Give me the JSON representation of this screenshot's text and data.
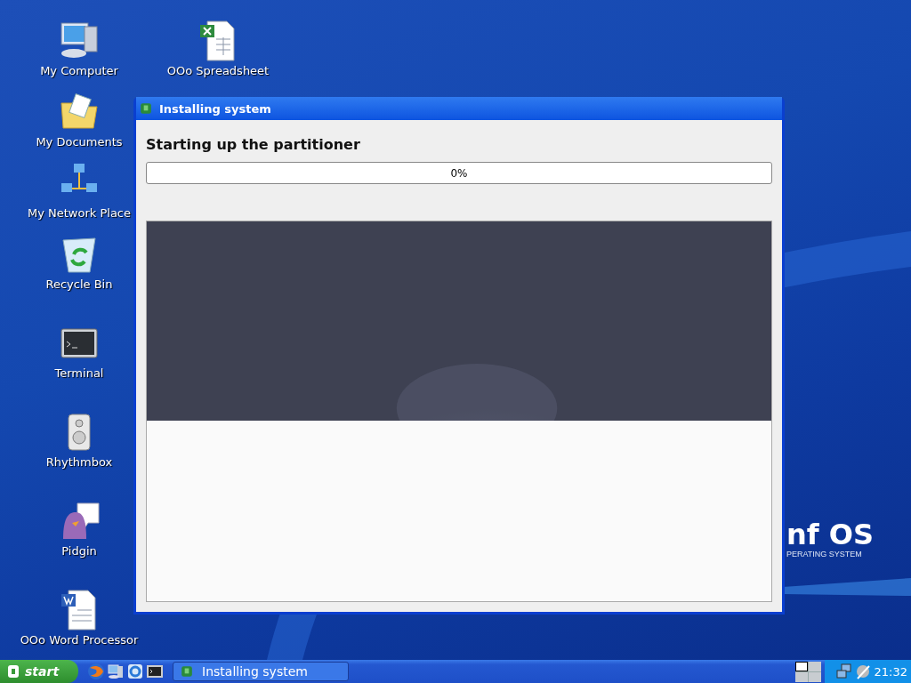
{
  "desktop_icons": [
    {
      "label": "My Computer"
    },
    {
      "label": "OOo Spreadsheet"
    },
    {
      "label": "My Documents"
    },
    {
      "label": "My Network Place"
    },
    {
      "label": "Recycle Bin"
    },
    {
      "label": "Terminal"
    },
    {
      "label": "Rhythmbox"
    },
    {
      "label": "Pidgin"
    },
    {
      "label": "OOo Word Processor"
    }
  ],
  "wallpaper_logo": {
    "name": "nf OS",
    "tagline": "PERATING SYSTEM"
  },
  "window": {
    "title": "Installing system",
    "heading": "Starting up the partitioner",
    "progress": {
      "level": 0,
      "reading": "0%"
    }
  },
  "taskbar": {
    "start": "start",
    "tasks": [
      {
        "label": "Installing system",
        "selected": false
      }
    ],
    "workspaces": [
      {
        "selected": true
      },
      {
        "selected": false
      },
      {
        "selected": false
      },
      {
        "selected": false
      }
    ],
    "clock": "21:32"
  }
}
